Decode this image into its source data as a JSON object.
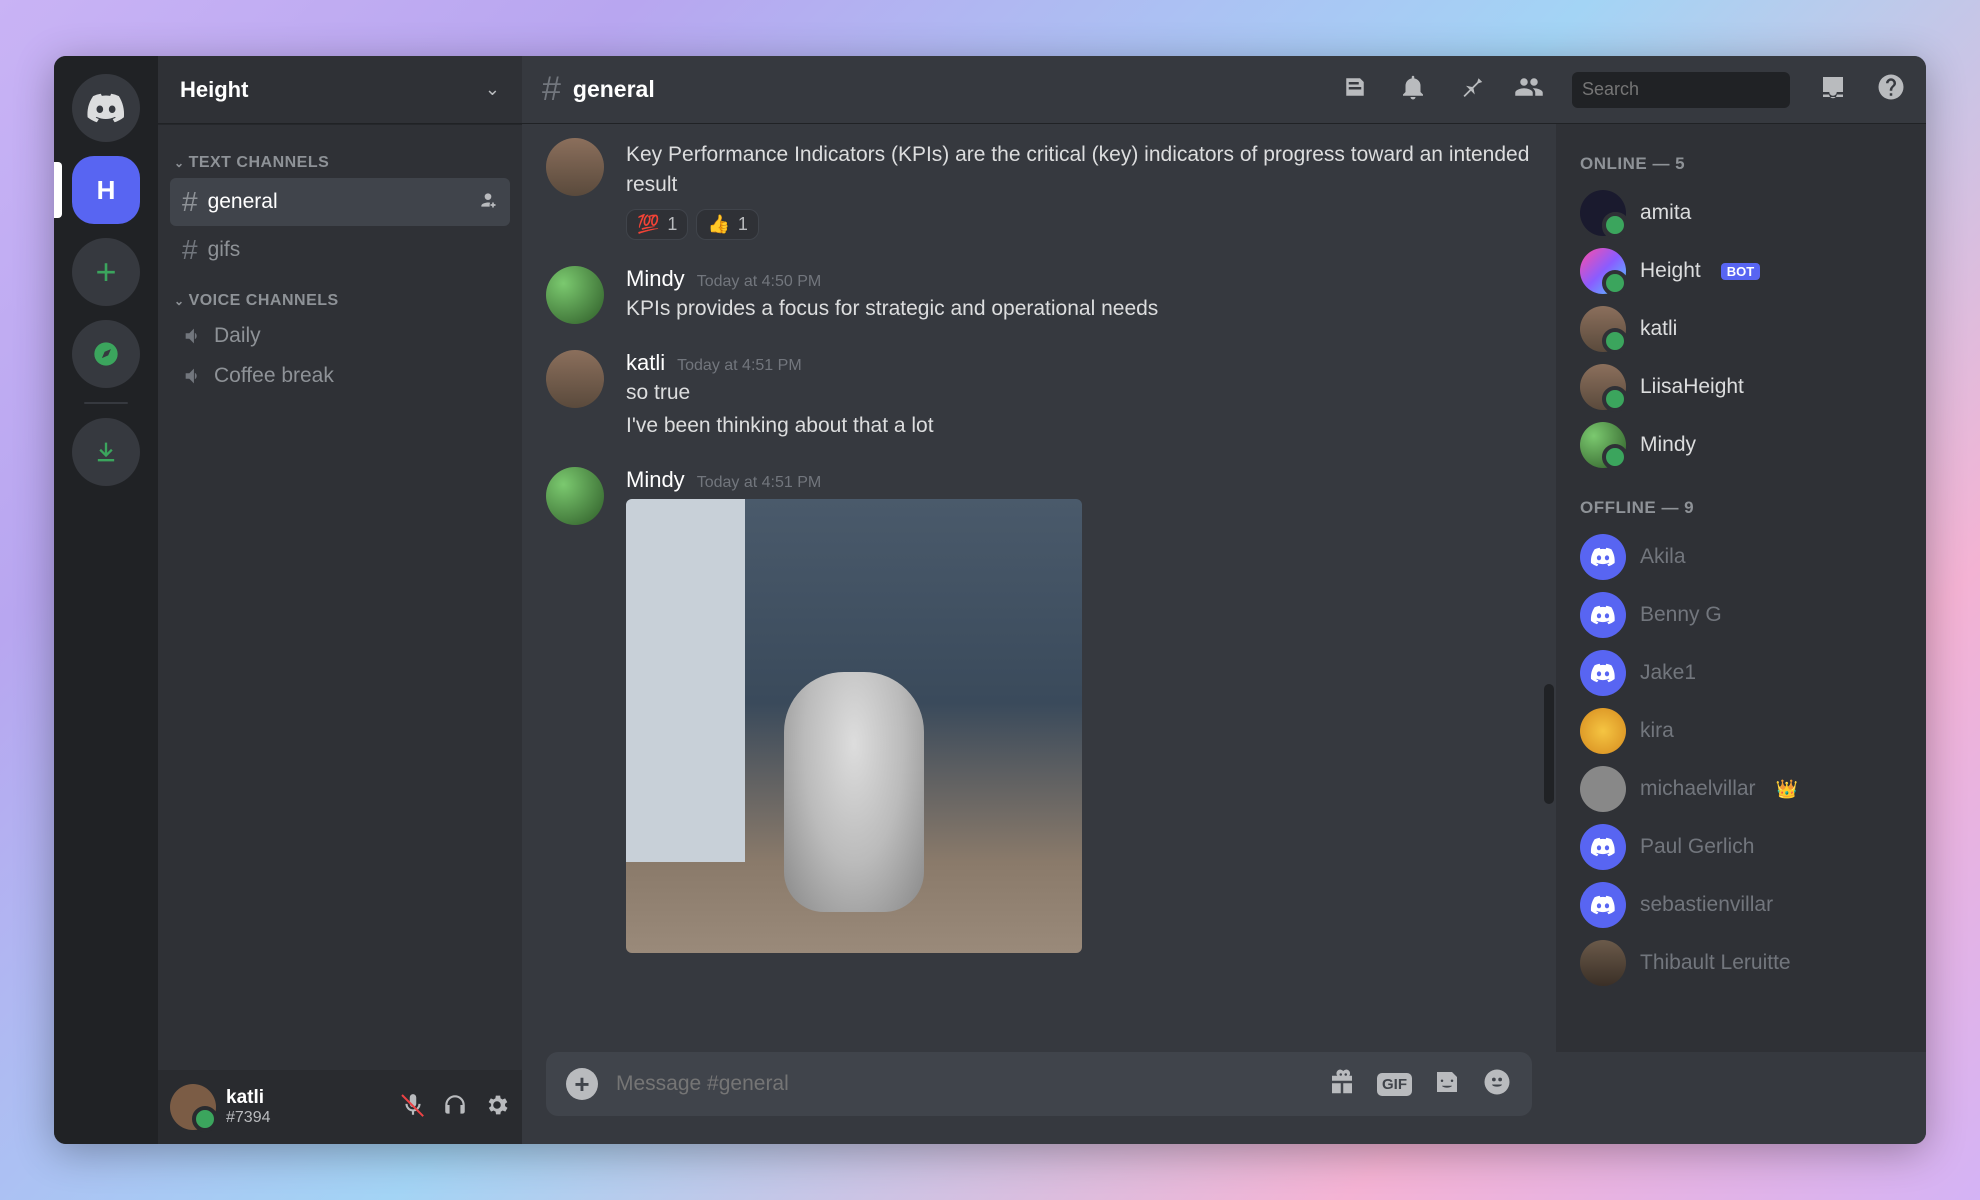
{
  "server_rail": {
    "active_initial": "H"
  },
  "server": {
    "name": "Height"
  },
  "sections": {
    "text_label": "TEXT CHANNELS",
    "voice_label": "VOICE CHANNELS"
  },
  "text_channels": [
    {
      "name": "general",
      "active": true
    },
    {
      "name": "gifs",
      "active": false
    }
  ],
  "voice_channels": [
    {
      "name": "Daily"
    },
    {
      "name": "Coffee break"
    }
  ],
  "user_panel": {
    "name": "katli",
    "tag": "#7394"
  },
  "chat": {
    "channel_name": "general",
    "search_placeholder": "Search",
    "composer_placeholder": "Message #general"
  },
  "messages": [
    {
      "author": "",
      "timestamp": "",
      "avatar": "brown",
      "lines": [
        "Key Performance Indicators (KPIs) are the critical (key) indicators of progress toward an intended result"
      ],
      "reactions": [
        {
          "emoji": "💯",
          "count": "1"
        },
        {
          "emoji": "👍",
          "count": "1"
        }
      ]
    },
    {
      "author": "Mindy",
      "timestamp": "Today at 4:50 PM",
      "avatar": "green",
      "lines": [
        "KPIs provides a focus for strategic and operational needs"
      ]
    },
    {
      "author": "katli",
      "timestamp": "Today at 4:51 PM",
      "avatar": "brown",
      "lines": [
        "so true",
        "I've been thinking about that a lot"
      ]
    },
    {
      "author": "Mindy",
      "timestamp": "Today at 4:51 PM",
      "avatar": "green",
      "image": true
    }
  ],
  "members": {
    "online_header": "ONLINE — 5",
    "offline_header": "OFFLINE — 9",
    "online": [
      {
        "name": "amita",
        "avatar": "dark",
        "status_decor": true
      },
      {
        "name": "Height",
        "avatar": "height",
        "bot": true
      },
      {
        "name": "katli",
        "avatar": "brown"
      },
      {
        "name": "LiisaHeight",
        "avatar": "tan"
      },
      {
        "name": "Mindy",
        "avatar": "green"
      }
    ],
    "offline": [
      {
        "name": "Akila",
        "avatar": "blurple"
      },
      {
        "name": "Benny G",
        "avatar": "blurple"
      },
      {
        "name": "Jake1",
        "avatar": "blurple"
      },
      {
        "name": "kira",
        "avatar": "orange"
      },
      {
        "name": "michaelvillar",
        "avatar": "gray",
        "crown": true
      },
      {
        "name": "Paul Gerlich",
        "avatar": "blurple"
      },
      {
        "name": "sebastienvillar",
        "avatar": "blurple"
      },
      {
        "name": "Thibault Leruitte",
        "avatar": "photo"
      }
    ]
  }
}
